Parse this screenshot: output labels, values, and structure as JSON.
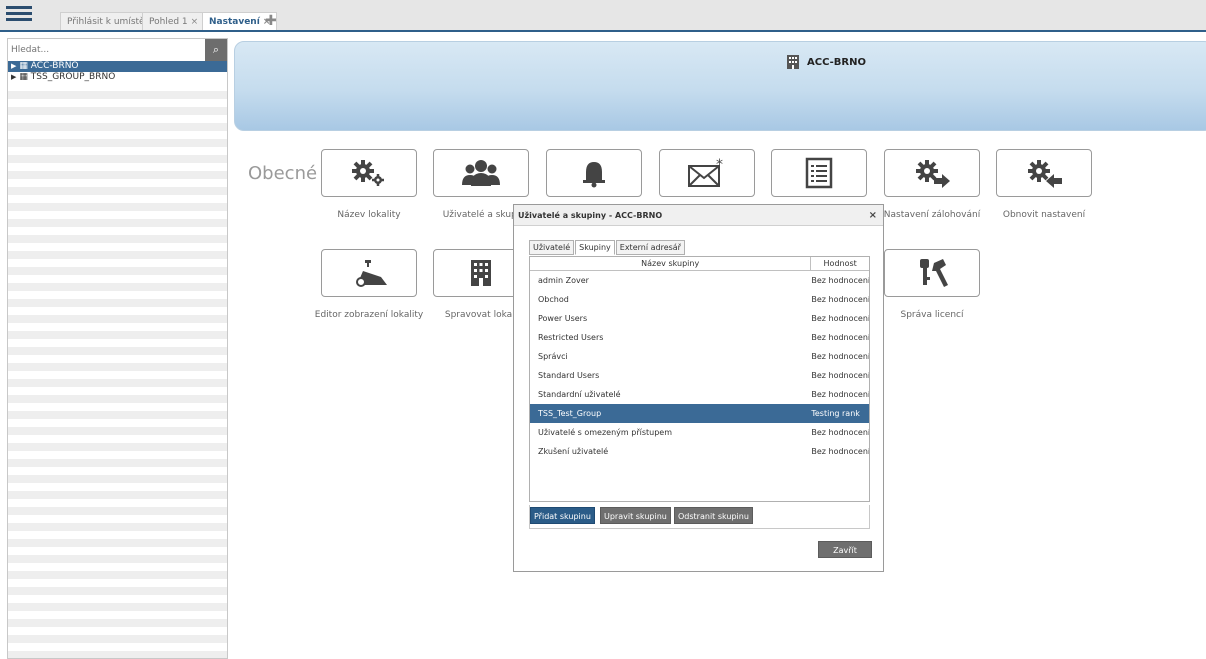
{
  "tabs": [
    {
      "label": "Přihlásit k umístění",
      "close": "×"
    },
    {
      "label": "Pohled 1",
      "close": "×"
    },
    {
      "label": "Nastavení",
      "close": "×"
    }
  ],
  "sidebar": {
    "search_placeholder": "Hledat...",
    "tree": [
      {
        "label": "ACC-BRNO",
        "selected": true
      },
      {
        "label": "TSS_GROUP_BRNO",
        "selected": false
      }
    ]
  },
  "banner": {
    "title": "ACC-BRNO"
  },
  "section": {
    "label": "Obecné",
    "tiles_row1": [
      {
        "label": "Název lokality",
        "icon": "gears-icon"
      },
      {
        "label": "Uživatelé a skupi",
        "icon": "users-icon"
      },
      {
        "label": "",
        "icon": "bell-icon"
      },
      {
        "label": "",
        "icon": "mail-icon"
      },
      {
        "label": "",
        "icon": "list-icon"
      },
      {
        "label": "Nastavení zálohování",
        "icon": "gear-export-icon"
      },
      {
        "label": "Obnovit nastavení",
        "icon": "gear-import-icon"
      }
    ],
    "tiles_row2": [
      {
        "label": "Editor zobrazení lokality",
        "icon": "camera-icon"
      },
      {
        "label": "Spravovat lokali",
        "icon": "building-icon"
      },
      {
        "label": "Správa licencí",
        "icon": "keys-icon"
      }
    ]
  },
  "dialog": {
    "title": "Uživatelé a skupiny - ACC-BRNO",
    "close": "×",
    "tabs": [
      "Uživatelé",
      "Skupiny",
      "Externí adresář"
    ],
    "columns": [
      "Název skupiny",
      "Hodnost"
    ],
    "rows": [
      {
        "name": "admin Zover",
        "rank": "Bez hodnocení"
      },
      {
        "name": "Obchod",
        "rank": "Bez hodnocení"
      },
      {
        "name": "Power Users",
        "rank": "Bez hodnocení"
      },
      {
        "name": "Restricted Users",
        "rank": "Bez hodnocení"
      },
      {
        "name": "Správci",
        "rank": "Bez hodnocení"
      },
      {
        "name": "Standard Users",
        "rank": "Bez hodnocení"
      },
      {
        "name": "Standardní uživatelé",
        "rank": "Bez hodnocení"
      },
      {
        "name": "TSS_Test_Group",
        "rank": "Testing rank"
      },
      {
        "name": "Uživatelé s omezeným přístupem",
        "rank": "Bez hodnocení"
      },
      {
        "name": "Zkušení uživatelé",
        "rank": "Bez hodnocení"
      }
    ],
    "selected_row": "TSS_Test_Group",
    "buttons": {
      "add": "Přidat skupinu",
      "edit": "Upravit skupinu",
      "remove": "Odstranit skupinu",
      "close": "Zavřít"
    }
  }
}
